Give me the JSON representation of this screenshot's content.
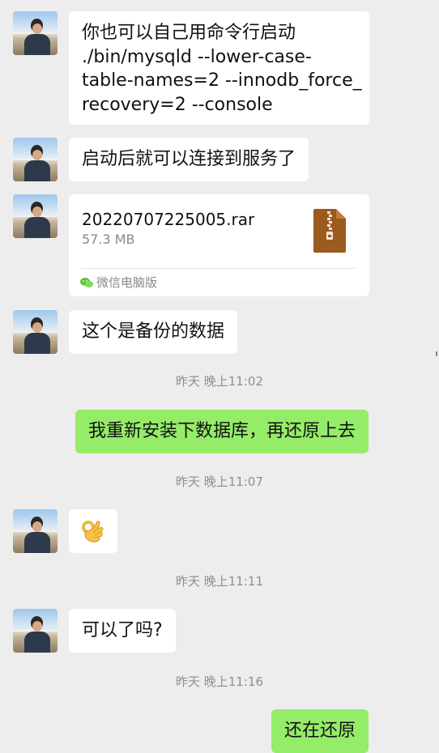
{
  "messages": {
    "m1": {
      "line1": "你也可以自己用命令行启动",
      "line2": "./bin/mysqld --lower-case-",
      "line3": "table-names=2 --innodb_force_",
      "line4": "recovery=2 --console"
    },
    "m2": "启动后就可以连接到服务了",
    "file": {
      "name": "20220707225005.rar",
      "size": "57.3 MB",
      "source": "微信电脑版",
      "icon": "archive-zip-icon"
    },
    "m3": "这个是备份的数据",
    "ts1": "昨天 晚上11:02",
    "m4": "我重新安装下数据库，再还原上去",
    "ts2": "昨天 晚上11:07",
    "m5_emoji": "ok-hand-icon",
    "ts3": "昨天 晚上11:11",
    "m6": "可以了吗?",
    "ts4": "昨天 晚上11:16",
    "m7_partial": "还在还原"
  },
  "colors": {
    "background": "#ededed",
    "incoming_bubble": "#ffffff",
    "outgoing_bubble": "#95ec69",
    "timestamp": "#8e8e8e"
  }
}
